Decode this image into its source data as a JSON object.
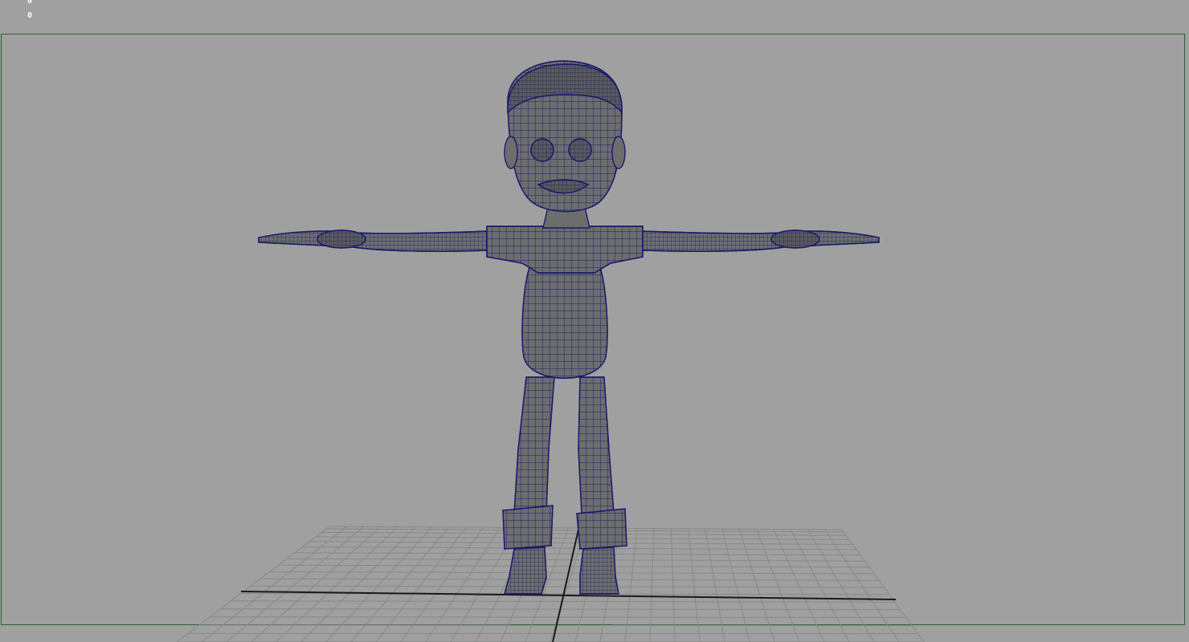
{
  "hud": {
    "line1": "0",
    "line2": "0"
  },
  "viewport": {
    "background": "#a0a0a0",
    "border_color": "#2f5d2f",
    "grid_color": "#8a8a8a",
    "axis_color": "#1a1a1a",
    "mesh_fill": "#6d6d6d",
    "mesh_shadow": "#4a4a4a",
    "wireframe_color": "#1a1a6e"
  }
}
